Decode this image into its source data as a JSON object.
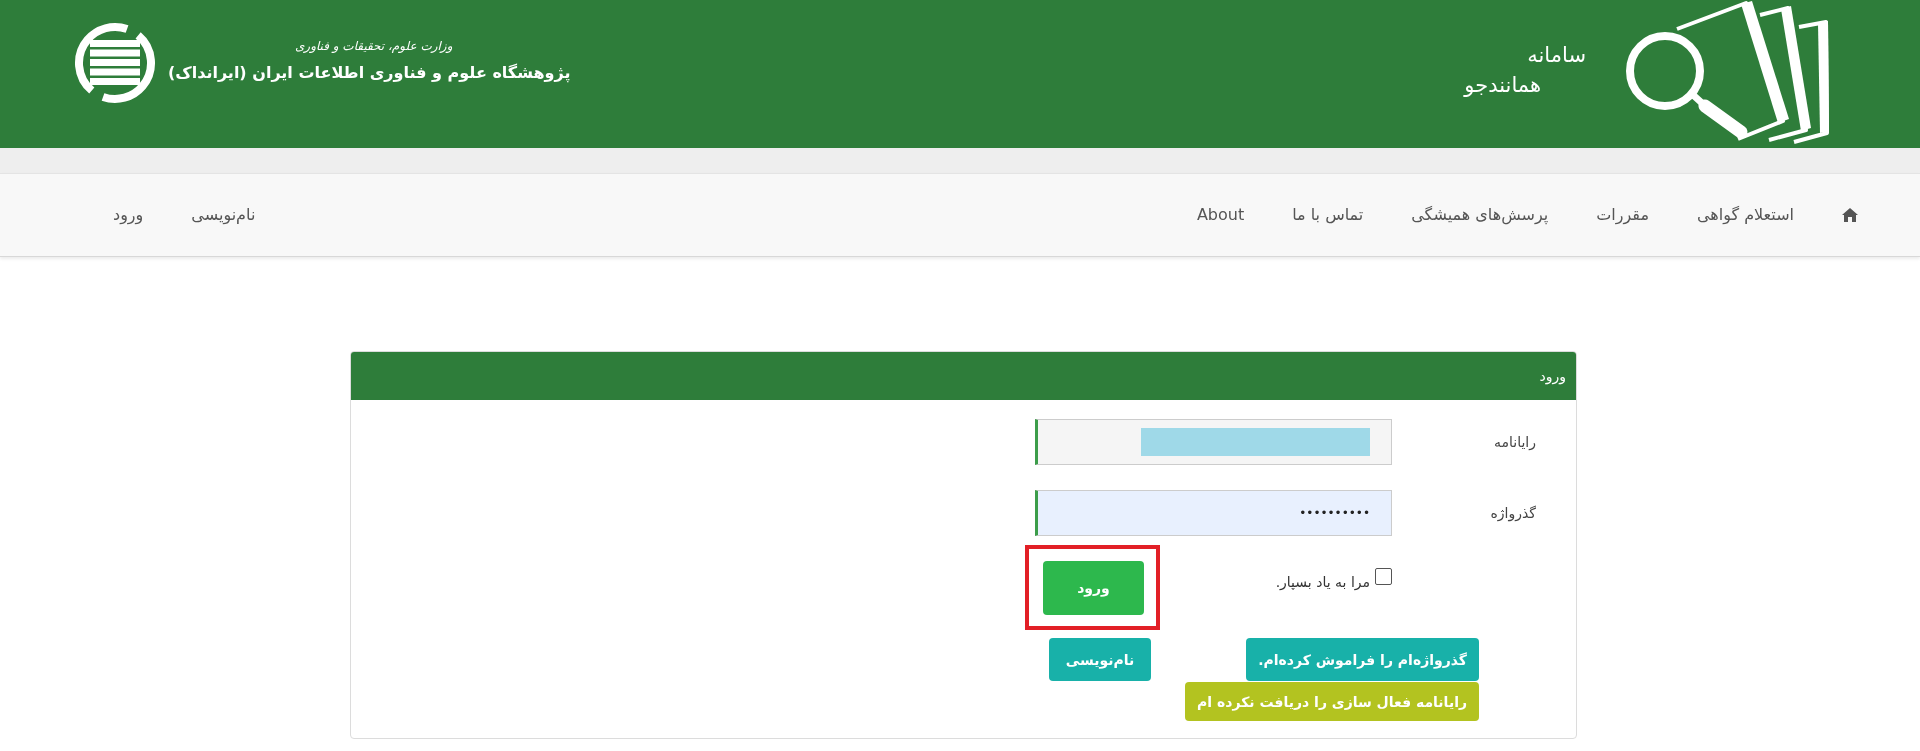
{
  "header": {
    "ministry": "وزارت علوم، تحقیقات و فناوری",
    "institute": "پژوهشگاه علوم و فناوری اطلاعات ایران (ایرانداک)",
    "system_label": "سامانه",
    "system_name": "همانندجو"
  },
  "nav": {
    "links": [
      "استعلام گواهی",
      "مقررات",
      "پرسش‌های همیشگی",
      "تماس با ما",
      "About"
    ],
    "account_links": [
      "نام‌نویسی",
      "ورود"
    ]
  },
  "login_panel": {
    "title": "ورود",
    "fields": [
      {
        "label": "رایانامه",
        "redacted": true,
        "autofilled": false
      },
      {
        "label": "گذرواژه",
        "value": "••••••••••",
        "redacted": false,
        "autofilled": true
      }
    ],
    "remember_me": {
      "label": "مرا به یاد بسپار.",
      "checked": false
    },
    "submit_button": {
      "label": "ورود",
      "highlighted": true
    },
    "help_buttons": [
      {
        "label": "گذرواژه‌ام را فراموش کرده‌ام.",
        "color": "#18b1a9"
      },
      {
        "label": "رایانامه فعال سازی را دریافت نکرده ام",
        "color": "#b3c320"
      }
    ],
    "register_button": {
      "label": "نام‌نویسی"
    }
  }
}
